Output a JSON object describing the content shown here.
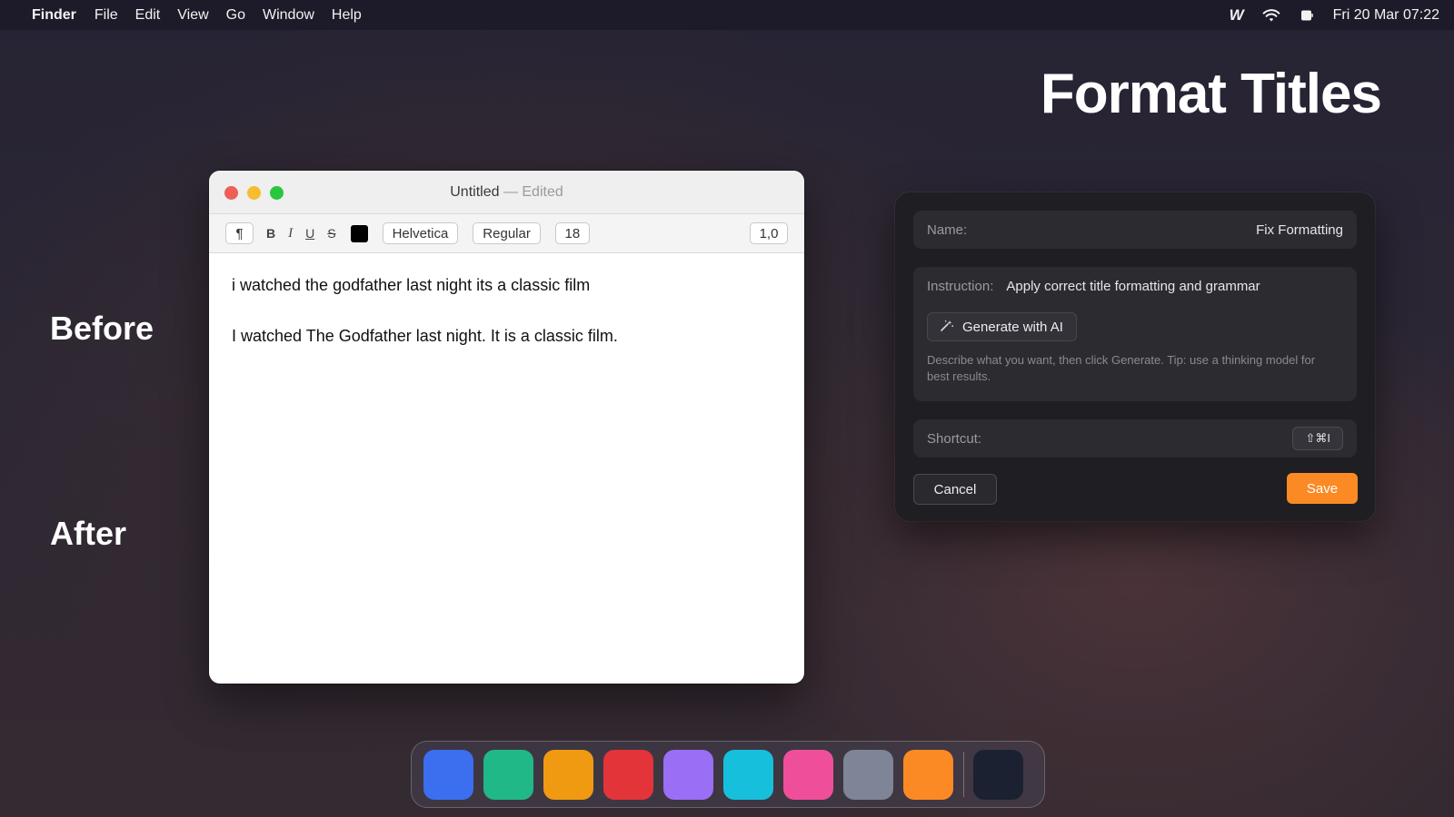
{
  "menubar": {
    "app": "Finder",
    "menus": [
      "File",
      "Edit",
      "View",
      "Go",
      "Window",
      "Help"
    ],
    "status": {
      "logo": "W",
      "wifi_icon": "wifi-icon",
      "battery_icon": "battery-icon",
      "datetime": "Fri 20 Mar  07:22"
    }
  },
  "page": {
    "title": "Format Titles",
    "before_label": "Before",
    "after_label": "After"
  },
  "editor": {
    "title": "Untitled",
    "edited": "— Edited",
    "toolbar": {
      "paragraph": "¶",
      "bold": "B",
      "italic": "I",
      "underline": "U",
      "strike": "S",
      "text_color": "#000000",
      "font": "Helvetica",
      "style": "Regular",
      "size": "18",
      "spacing": "1,0"
    },
    "lines": [
      "i watched the godfather last night its a classic film",
      "I watched The Godfather last night. It is a classic film."
    ]
  },
  "panel": {
    "name_label": "Name:",
    "name_value": "Fix Formatting",
    "instruction_label": "Instruction:",
    "instruction_value": "Apply correct title formatting and grammar",
    "generate_label": "Generate with AI",
    "tip": "Describe what you want, then click Generate. Tip: use a thinking model for best results.",
    "shortcut_label": "Shortcut:",
    "shortcut_value": "⇧⌘I",
    "cancel_label": "Cancel",
    "save_label": "Save",
    "accent": "#fb8a25"
  },
  "dock": {
    "icons": [
      {
        "name": "dock-app-blue",
        "color": "#3c6ef0"
      },
      {
        "name": "dock-app-green",
        "color": "#20b887"
      },
      {
        "name": "dock-app-amber",
        "color": "#f09a12"
      },
      {
        "name": "dock-app-red",
        "color": "#e3343a"
      },
      {
        "name": "dock-app-purple",
        "color": "#9a6ef5"
      },
      {
        "name": "dock-app-cyan",
        "color": "#16c0dc"
      },
      {
        "name": "dock-app-pink",
        "color": "#ef4f9a"
      },
      {
        "name": "dock-app-gray",
        "color": "#7d8596"
      },
      {
        "name": "dock-app-orange",
        "color": "#fb8a25"
      },
      {
        "name": "dock-app-dark",
        "color": "#1b2130"
      }
    ]
  }
}
